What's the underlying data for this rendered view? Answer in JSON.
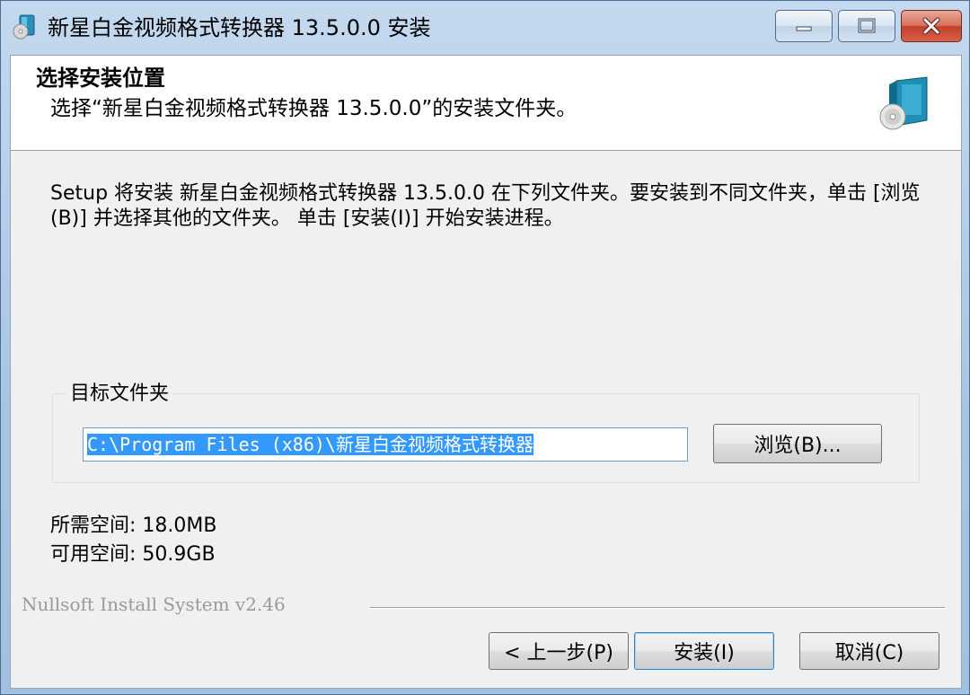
{
  "window": {
    "title": "新星白金视频格式转换器 13.5.0.0 安装"
  },
  "header": {
    "title": "选择安装位置",
    "subtitle": "选择“新星白金视频格式转换器 13.5.0.0”的安装文件夹。"
  },
  "description": "Setup 将安装 新星白金视频格式转换器 13.5.0.0 在下列文件夹。要安装到不同文件夹，单击 [浏览(B)] 并选择其他的文件夹。 单击 [安装(I)] 开始安装进程。",
  "destination": {
    "group_label": "目标文件夹",
    "path_value": "C:\\Program Files (x86)\\新星白金视频格式转换器",
    "browse_label": "浏览(B)..."
  },
  "space": {
    "required_label": "所需空间:",
    "required_value": "18.0MB",
    "available_label": "可用空间:",
    "available_value": "50.9GB"
  },
  "branding": "Nullsoft Install System v2.46",
  "buttons": {
    "back": "< 上一步(P)",
    "install": "安装(I)",
    "cancel": "取消(C)"
  },
  "icons": {
    "title": "installer-icon",
    "header": "software-box-icon",
    "minimize": "minimize-icon",
    "maximize": "maximize-icon",
    "close": "close-icon"
  },
  "colors": {
    "selection": "#3399ff",
    "close_button": "#c2412b",
    "titlebar": "#c4d9ef"
  }
}
